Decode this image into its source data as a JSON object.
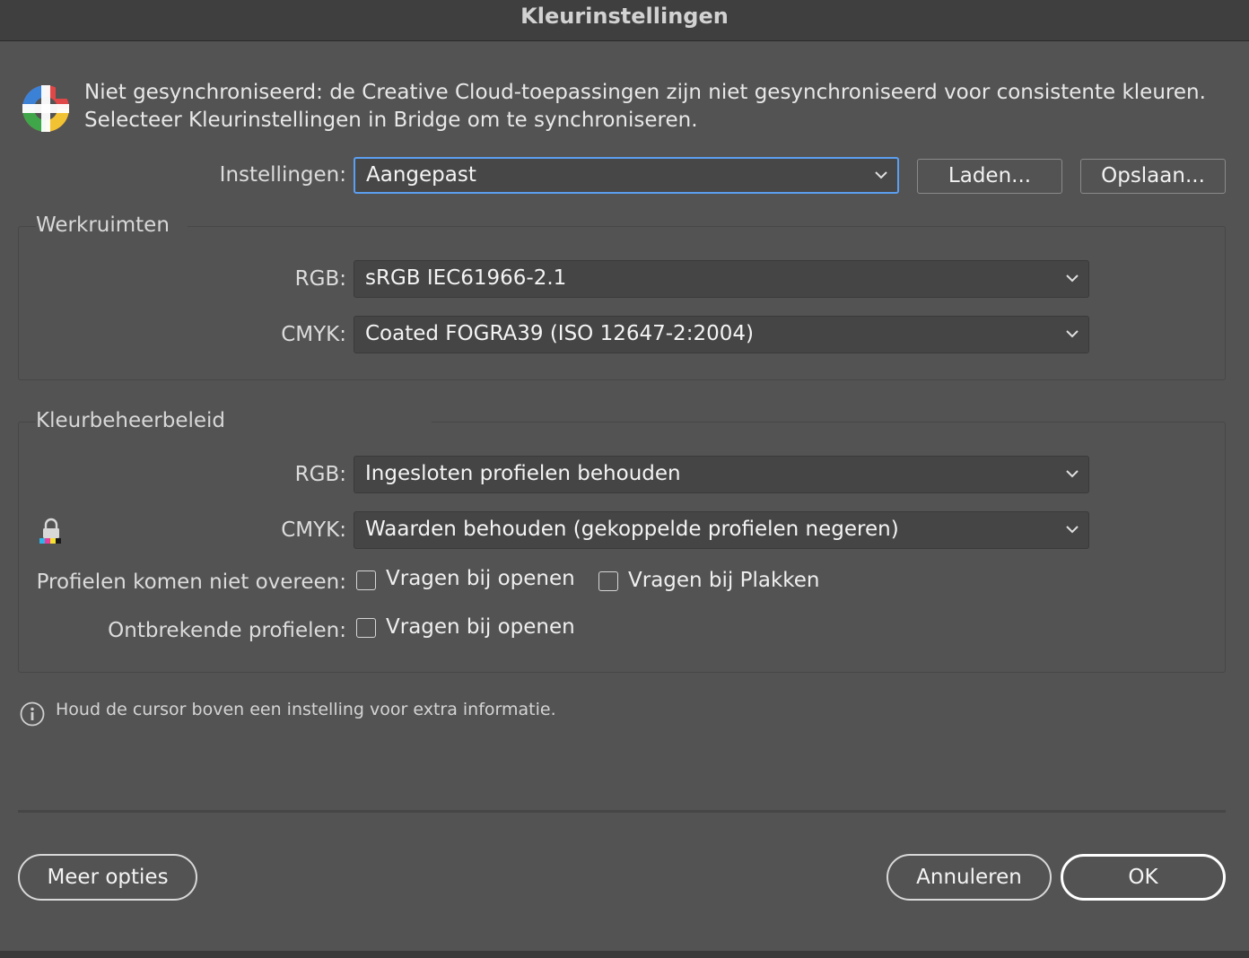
{
  "window": {
    "title": "Kleurinstellingen"
  },
  "sync": {
    "line1": "Niet gesynchroniseerd: de Creative Cloud-toepassingen zijn niet gesynchroniseerd voor consistente kleuren.",
    "line2": "Selecteer Kleurinstellingen in Bridge om te synchroniseren."
  },
  "settings": {
    "label": "Instellingen:",
    "value": "Aangepast",
    "load_button": "Laden...",
    "save_button": "Opslaan..."
  },
  "workspaces": {
    "title": "Werkruimten",
    "rgb_label": "RGB:",
    "rgb_value": "sRGB IEC61966-2.1",
    "cmyk_label": "CMYK:",
    "cmyk_value": "Coated FOGRA39 (ISO 12647-2:2004)"
  },
  "policy": {
    "title": "Kleurbeheerbeleid",
    "rgb_label": "RGB:",
    "rgb_value": "Ingesloten profielen behouden",
    "cmyk_label": "CMYK:",
    "cmyk_value": "Waarden behouden (gekoppelde profielen negeren)",
    "mismatch_label": "Profielen komen niet overeen:",
    "mismatch_ask_open": "Vragen bij openen",
    "mismatch_ask_paste": "Vragen bij Plakken",
    "missing_label": "Ontbrekende profielen:",
    "missing_ask_open": "Vragen bij openen",
    "checked": {
      "mismatch_open": false,
      "mismatch_paste": false,
      "missing_open": false
    }
  },
  "info": {
    "text": "Houd de cursor boven een instelling voor extra informatie."
  },
  "footer": {
    "more_options": "Meer opties",
    "cancel": "Annuleren",
    "ok": "OK"
  },
  "colors": {
    "focus": "#5b9ff0",
    "background": "#535353"
  },
  "icons": [
    "sync-status-icon",
    "chevron-down-icon",
    "lock-icon",
    "info-icon"
  ]
}
